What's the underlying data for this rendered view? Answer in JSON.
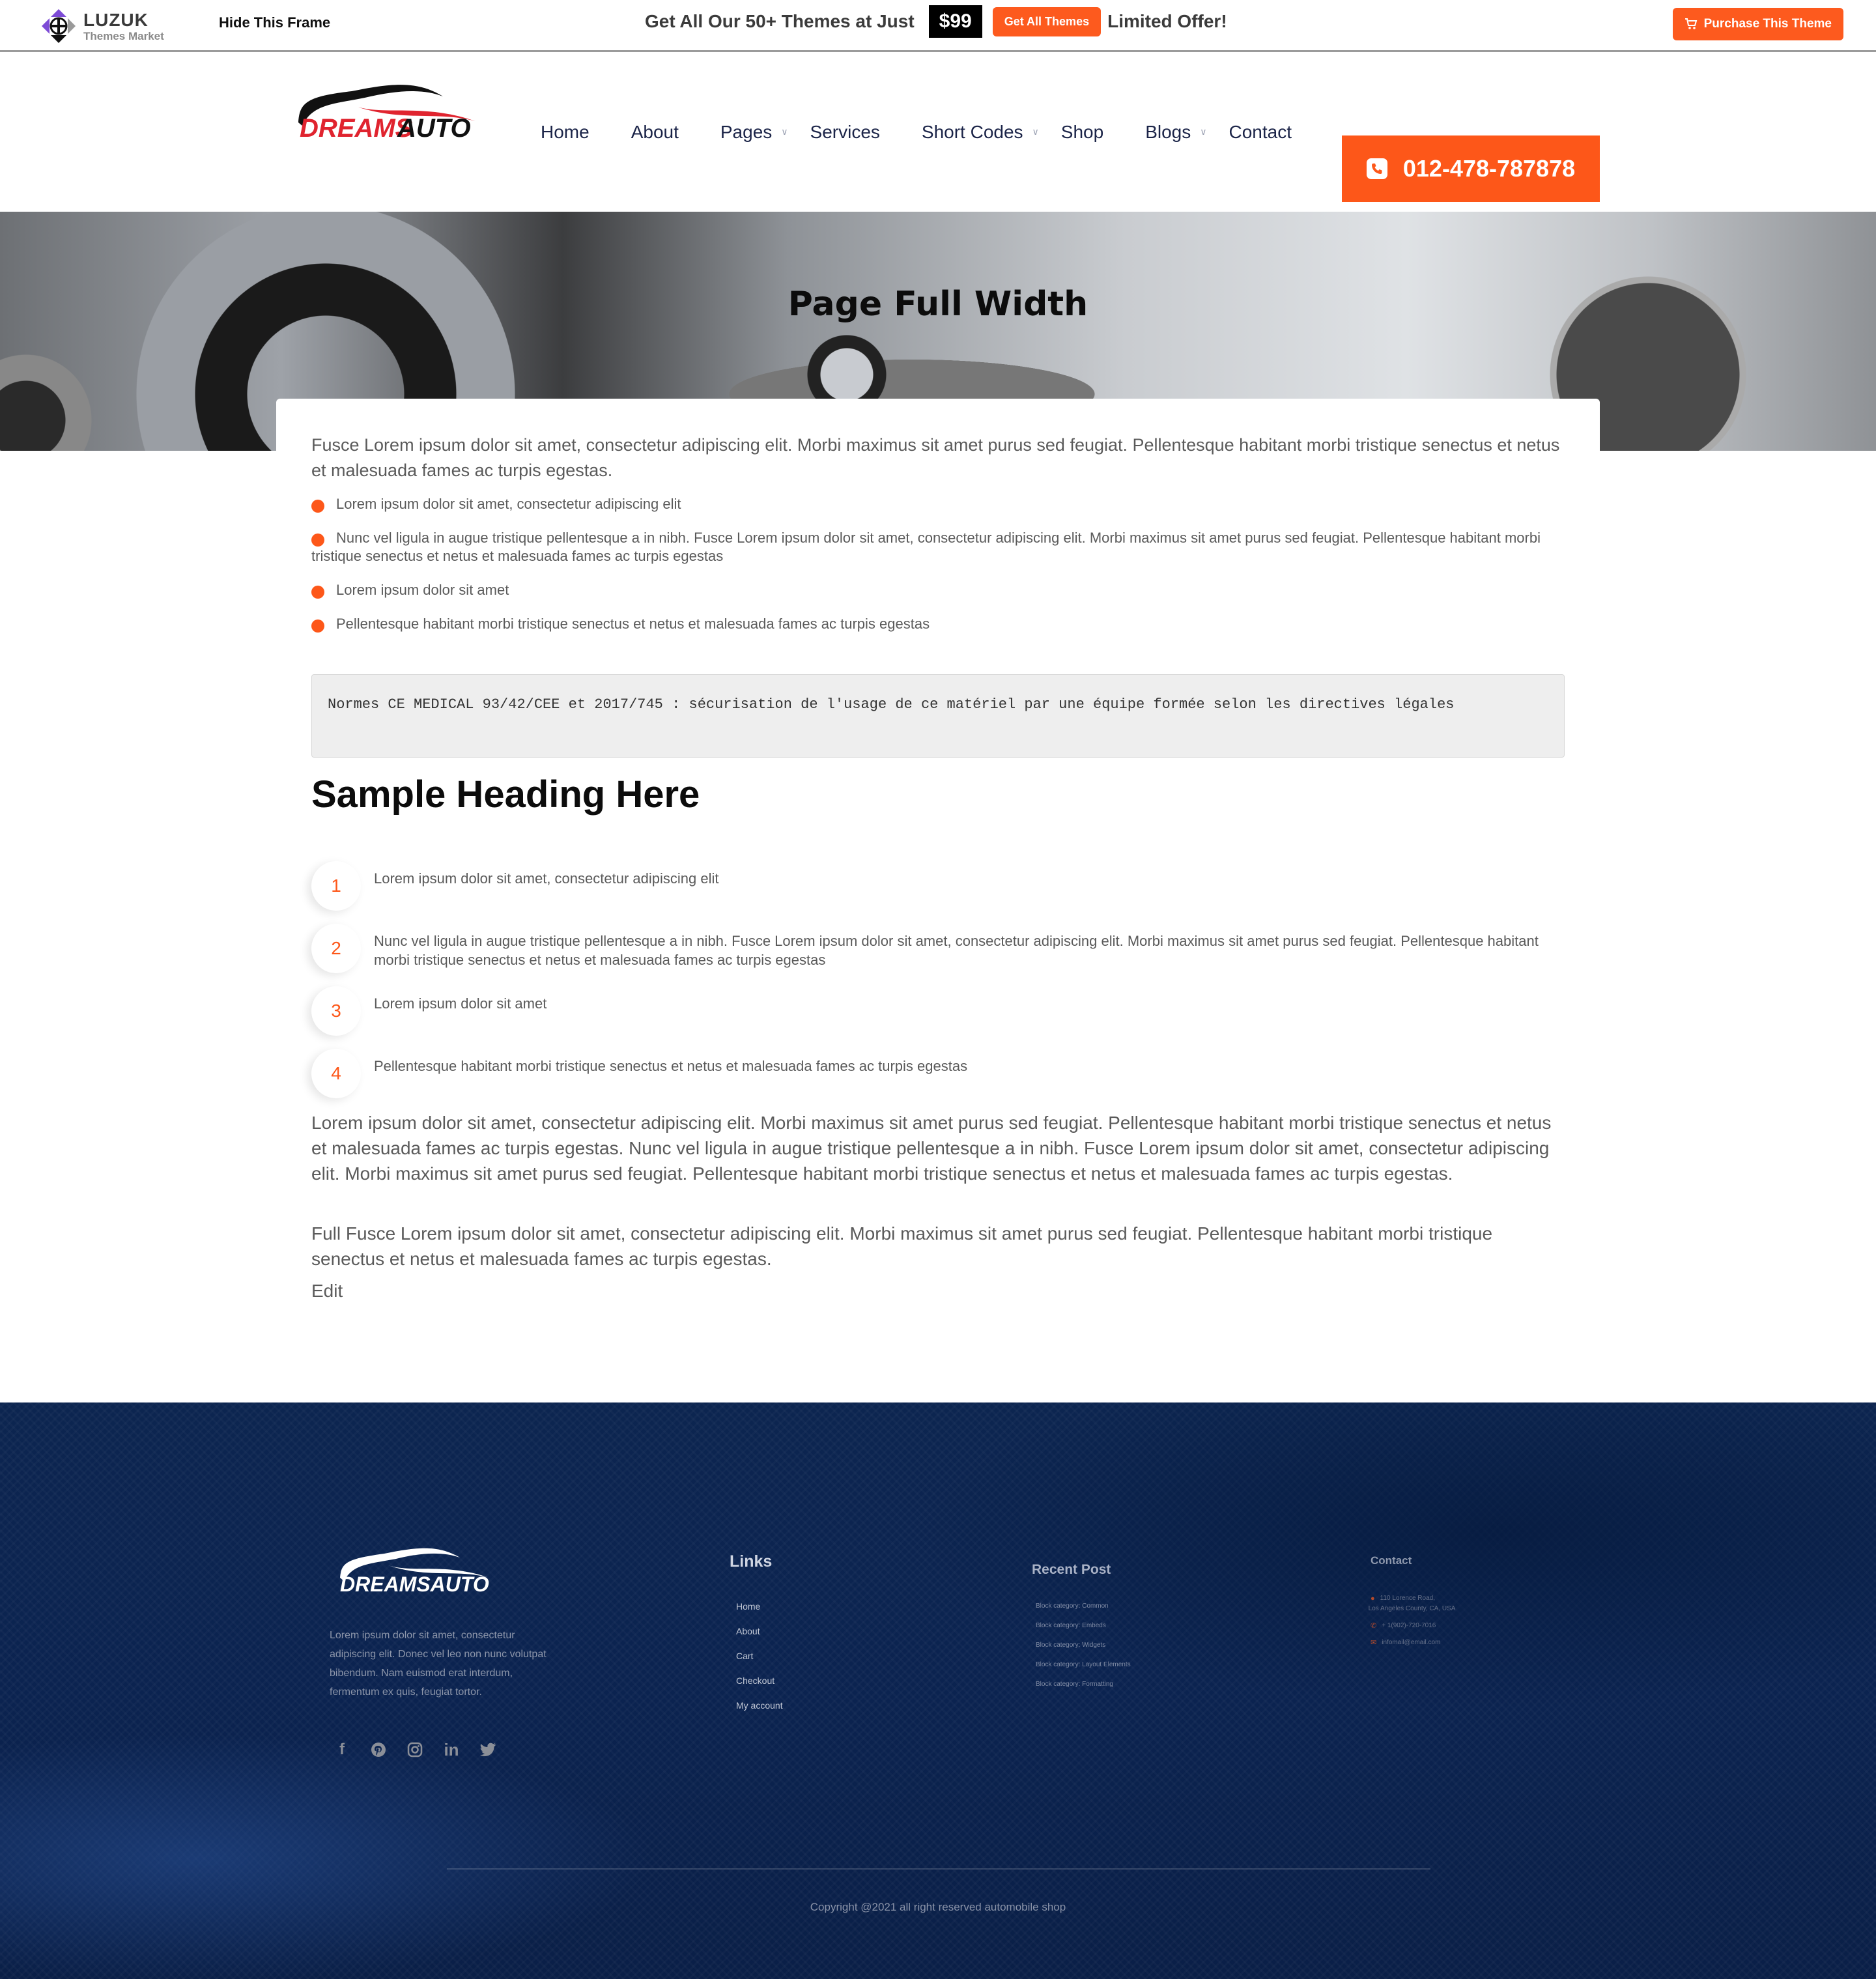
{
  "promo_bar": {
    "vendor_name": "LUZUK",
    "vendor_tagline": "Themes Market",
    "hide_frame_label": "Hide This Frame",
    "offer_text": "Get All Our 50+ Themes at Just",
    "price": "$99",
    "get_all_label": "Get All Themes",
    "limited_offer": "Limited Offer!",
    "purchase_label": "Purchase This Theme",
    "accent_color": "#fd5a1e"
  },
  "header": {
    "brand_name_red": "DREAMS",
    "brand_name_black": "AUTO",
    "nav": [
      {
        "label": "Home",
        "has_submenu": false
      },
      {
        "label": "About",
        "has_submenu": false
      },
      {
        "label": "Pages",
        "has_submenu": true
      },
      {
        "label": "Services",
        "has_submenu": false
      },
      {
        "label": "Short Codes",
        "has_submenu": true
      },
      {
        "label": "Shop",
        "has_submenu": false
      },
      {
        "label": "Blogs",
        "has_submenu": true
      },
      {
        "label": "Contact",
        "has_submenu": false
      }
    ],
    "phone": "012-478-787878",
    "phone_icon": "phone-icon",
    "accent_color": "#fd5719"
  },
  "hero": {
    "title": "Page Full Width"
  },
  "content": {
    "intro": "Fusce Lorem ipsum dolor sit amet, consectetur adipiscing elit. Morbi maximus sit amet purus sed feugiat. Pellentesque habitant morbi tristique senectus et netus et malesuada fames ac turpis egestas.",
    "bullets": [
      "Lorem ipsum dolor sit amet, consectetur adipiscing elit",
      "Nunc vel ligula in augue tristique pellentesque a in nibh. Fusce Lorem ipsum dolor sit amet, consectetur adipiscing elit. Morbi maximus sit amet purus sed feugiat. Pellentesque habitant morbi tristique senectus et netus et malesuada fames ac turpis egestas",
      "Lorem ipsum dolor sit amet",
      "Pellentesque habitant morbi tristique senectus et netus et malesuada fames ac turpis egestas"
    ],
    "code_block": "Normes CE MEDICAL 93/42/CEE et 2017/745 : sécurisation de l'usage de ce matériel par une équipe formée selon les directives légales",
    "heading": "Sample Heading Here",
    "steps": [
      {
        "num": "1",
        "text": "Lorem ipsum dolor sit amet, consectetur adipiscing elit"
      },
      {
        "num": "2",
        "text": "Nunc vel ligula in augue tristique pellentesque a in nibh. Fusce Lorem ipsum dolor sit amet, consectetur adipiscing elit. Morbi maximus sit amet purus sed feugiat. Pellentesque habitant morbi tristique senectus et netus et malesuada fames ac turpis egestas"
      },
      {
        "num": "3",
        "text": "Lorem ipsum dolor sit amet"
      },
      {
        "num": "4",
        "text": "Pellentesque habitant morbi tristique senectus et netus et malesuada fames ac turpis egestas"
      }
    ],
    "paragraph_1": "Lorem ipsum dolor sit amet, consectetur adipiscing elit. Morbi maximus sit amet purus sed feugiat. Pellentesque habitant morbi tristique senectus et netus et malesuada fames ac turpis egestas. Nunc vel ligula in augue tristique pellentesque a in nibh. Fusce Lorem ipsum dolor sit amet, consectetur adipiscing elit. Morbi maximus sit amet purus sed feugiat. Pellentesque habitant morbi tristique senectus et netus et malesuada fames ac turpis egestas.",
    "paragraph_2": "Full Fusce Lorem ipsum dolor sit amet, consectetur adipiscing elit. Morbi maximus sit amet purus sed feugiat. Pellentesque habitant morbi tristique senectus et netus et malesuada fames ac turpis egestas.",
    "edit_label": "Edit"
  },
  "footer": {
    "brand_name": "DREAMSAUTO",
    "about": "Lorem ipsum dolor sit amet, consectetur adipiscing elit. Donec vel leo non nunc volutpat bibendum. Nam euismod erat interdum, fermentum ex quis, feugiat tortor.",
    "socials": [
      {
        "icon": "facebook-icon",
        "glyph": "f"
      },
      {
        "icon": "pinterest-icon",
        "glyph": "P"
      },
      {
        "icon": "instagram-icon",
        "glyph": "◎"
      },
      {
        "icon": "linkedin-icon",
        "glyph": "in"
      },
      {
        "icon": "twitter-icon",
        "glyph": "🐦"
      }
    ],
    "links_title": "Links",
    "links": [
      "Home",
      "About",
      "Cart",
      "Checkout",
      "My account"
    ],
    "recent_title": "Recent Post",
    "recent_posts": [
      "Block category: Common",
      "Block category: Embeds",
      "Block category: Widgets",
      "Block category: Layout Elements",
      "Block category: Formatting"
    ],
    "contact_title": "Contact",
    "address_line1": "110 Lorence Road,",
    "address_line2": "Los Angeles County, CA, USA",
    "phone": "+ 1(902)-720-7016",
    "email": "infomail@email.com",
    "copyright": "Copyright @2021 all right reserved automobile shop"
  }
}
